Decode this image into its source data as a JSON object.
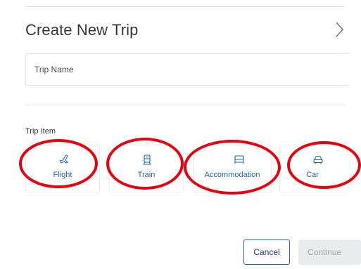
{
  "dialog": {
    "title": "Create New Trip",
    "next_icon": "chevron-right-icon"
  },
  "trip_name": {
    "placeholder": "Trip Name",
    "value": ""
  },
  "trip_item": {
    "label": "Trip Item",
    "items": [
      {
        "label": "Flight",
        "icon": "plane-icon"
      },
      {
        "label": "Train",
        "icon": "train-icon"
      },
      {
        "label": "Accommodation",
        "icon": "bed-icon"
      },
      {
        "label": "Car",
        "icon": "car-icon"
      }
    ]
  },
  "annotations": {
    "color": "#e8000f",
    "shape": "ellipse",
    "count": 4
  },
  "footer": {
    "cancel_label": "Cancel",
    "continue_label": "Continue",
    "continue_enabled": false
  },
  "colors": {
    "accent": "#1f64b3",
    "annotation": "#e8000f",
    "disabled_bg": "#e9ecef",
    "disabled_text": "#a4a9ae"
  }
}
